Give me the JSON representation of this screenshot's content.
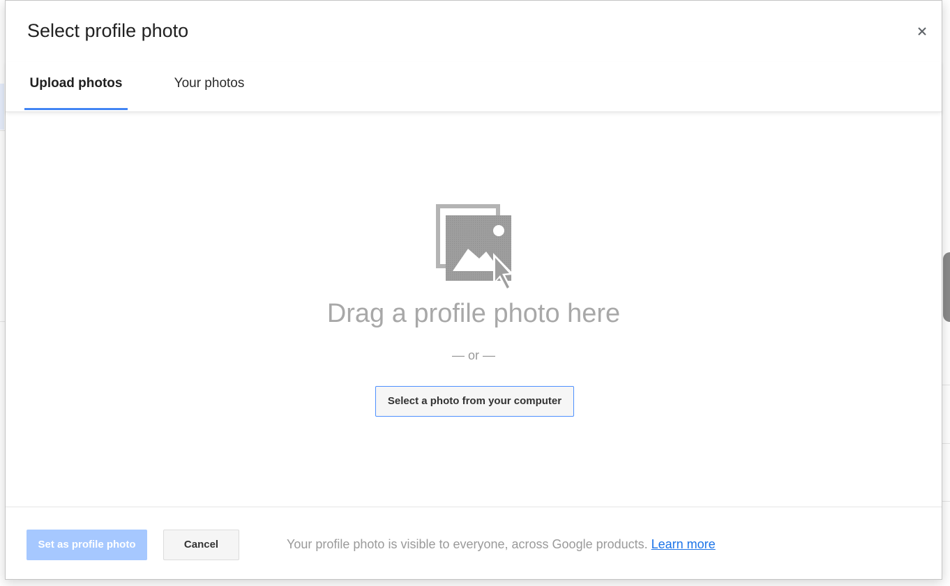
{
  "dialog": {
    "title": "Select profile photo",
    "close_icon": "close-icon"
  },
  "tabs": [
    {
      "label": "Upload photos",
      "active": true
    },
    {
      "label": "Your photos",
      "active": false
    }
  ],
  "upload": {
    "drag_text": "Drag a profile photo here",
    "or_text": "— or —",
    "select_button": "Select a photo from your computer",
    "illustration_icon": "photo-drag-icon"
  },
  "footer": {
    "set_button": "Set as profile photo",
    "set_button_disabled": true,
    "cancel_button": "Cancel",
    "note": "Your profile photo is visible to everyone, across Google products.",
    "learn_more": "Learn more"
  },
  "colors": {
    "accent": "#4285f4",
    "disabled_primary": "#a6c8ff",
    "link": "#1a73e8",
    "muted_text": "#9a9a9a"
  }
}
